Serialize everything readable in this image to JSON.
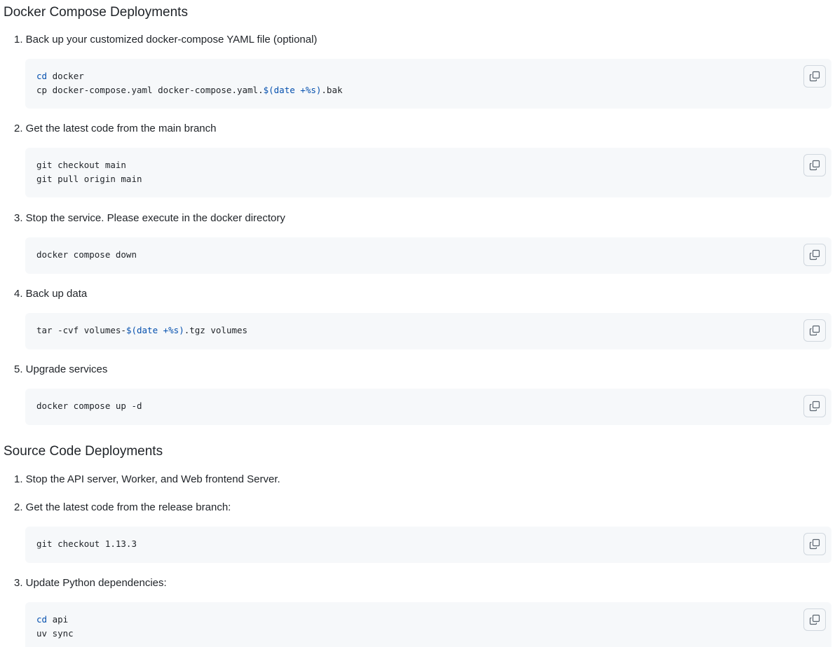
{
  "docker_section": {
    "title": "Docker Compose Deployments",
    "steps": [
      {
        "label": "1. Back up your customized docker-compose YAML file (optional)"
      },
      {
        "label": "2. Get the latest code from the main branch"
      },
      {
        "label": "3. Stop the service. Please execute in the docker directory"
      },
      {
        "label": "4. Back up data"
      },
      {
        "label": "5. Upgrade services"
      }
    ],
    "code": {
      "step1": {
        "line1_cmd": "cd",
        "line1_rest": " docker",
        "line2_a": "cp docker-compose.yaml docker-compose.yaml.",
        "line2_kw": "$(date +%s)",
        "line2_b": ".bak"
      },
      "step2": {
        "line1": "git checkout main",
        "line2": "git pull origin main"
      },
      "step3": {
        "line1": "docker compose down"
      },
      "step4": {
        "line_a": "tar -cvf volumes-",
        "line_kw": "$(date +%s)",
        "line_b": ".tgz volumes"
      },
      "step5": {
        "line1": "docker compose up -d"
      }
    }
  },
  "source_section": {
    "title": "Source Code Deployments",
    "steps": [
      {
        "label": "1. Stop the API server, Worker, and Web frontend Server."
      },
      {
        "label": "2. Get the latest code from the release branch:"
      },
      {
        "label": "3. Update Python dependencies:"
      }
    ],
    "code": {
      "step2": {
        "line1": "git checkout 1.13.3"
      },
      "step3": {
        "line1_cmd": "cd",
        "line1_rest": " api",
        "line2": "uv sync"
      }
    }
  },
  "icons": {
    "copy": "copy-icon"
  },
  "colors": {
    "code_bg": "#f6f8fa",
    "keyword": "#0550ae",
    "border": "#d0d7de"
  }
}
